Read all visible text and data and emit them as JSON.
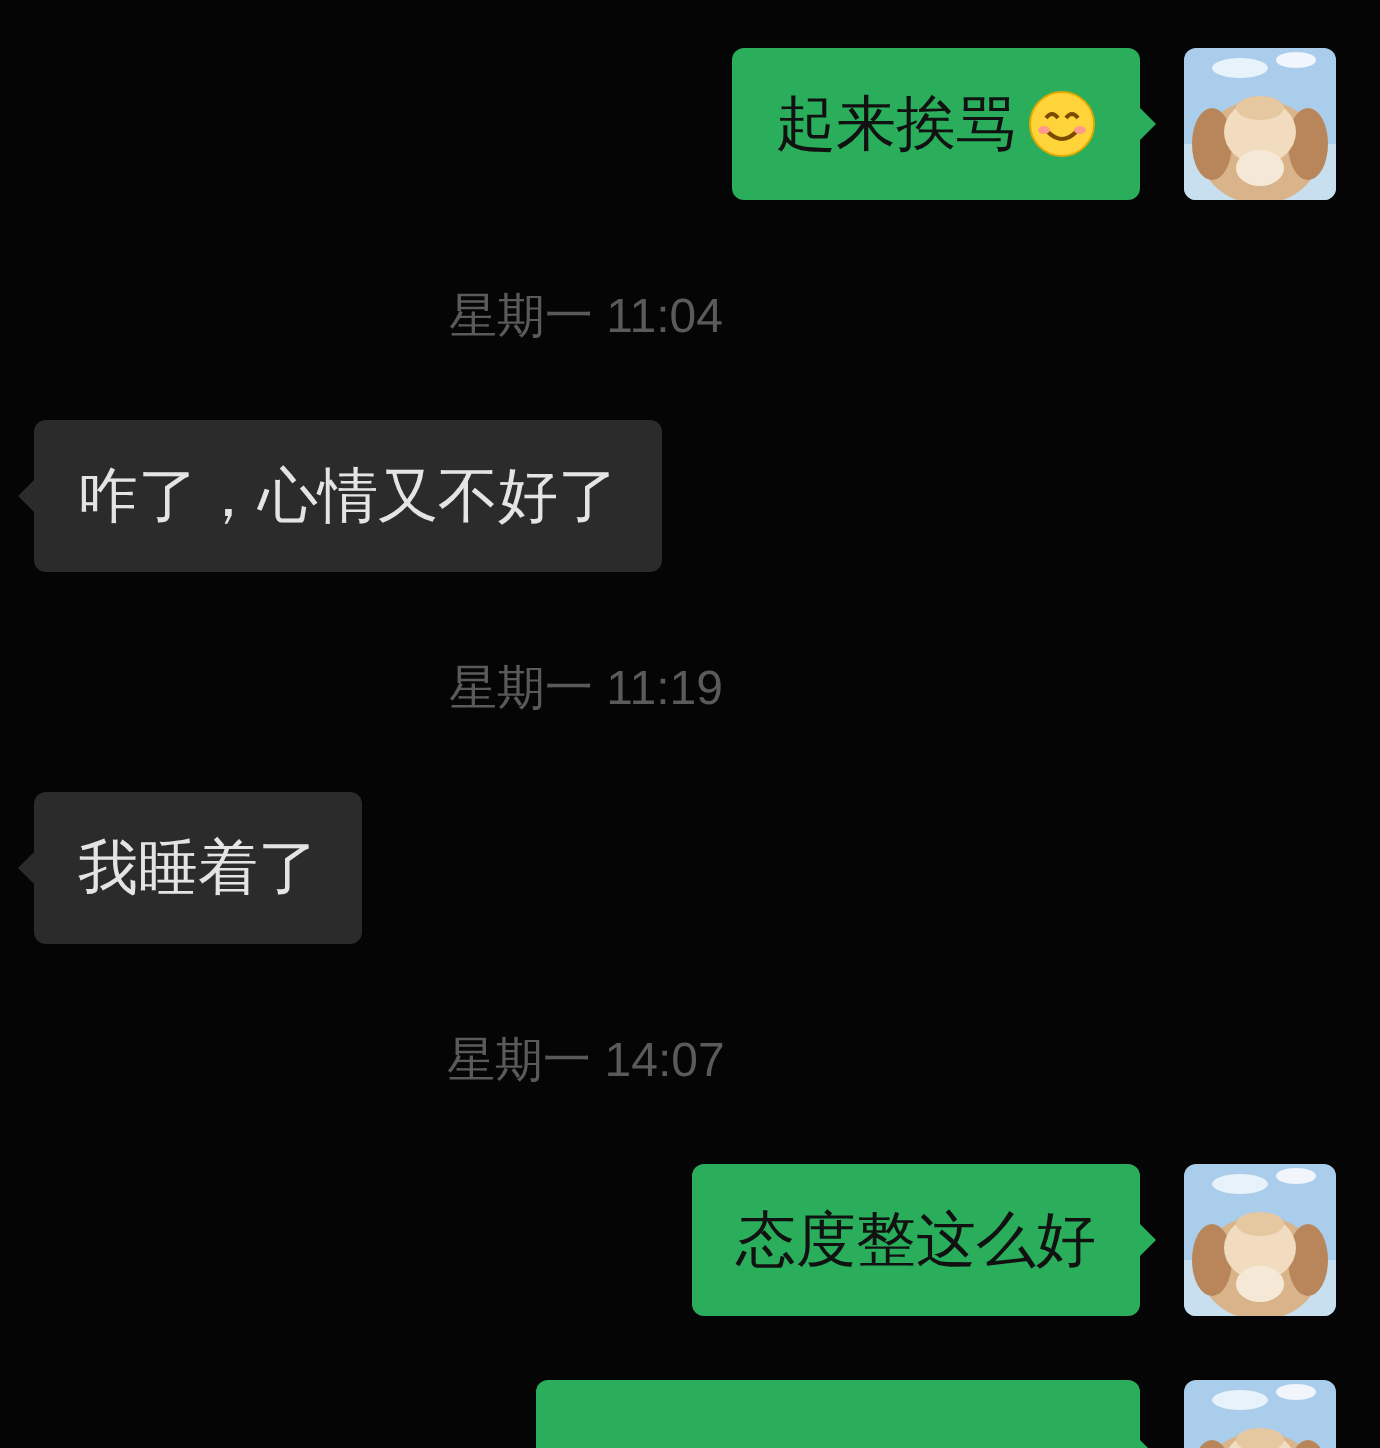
{
  "messages": [
    {
      "kind": "mine",
      "text": "起来挨骂",
      "emoji": true
    },
    {
      "kind": "time",
      "text": "星期一 11:04"
    },
    {
      "kind": "theirs",
      "text": "咋了，心情又不好了"
    },
    {
      "kind": "time",
      "text": "星期一 11:19"
    },
    {
      "kind": "theirs",
      "text": "我睡着了"
    },
    {
      "kind": "time",
      "text": "星期一 14:07"
    },
    {
      "kind": "mine",
      "text": "态度整这么好"
    },
    {
      "kind": "mine"
    }
  ]
}
